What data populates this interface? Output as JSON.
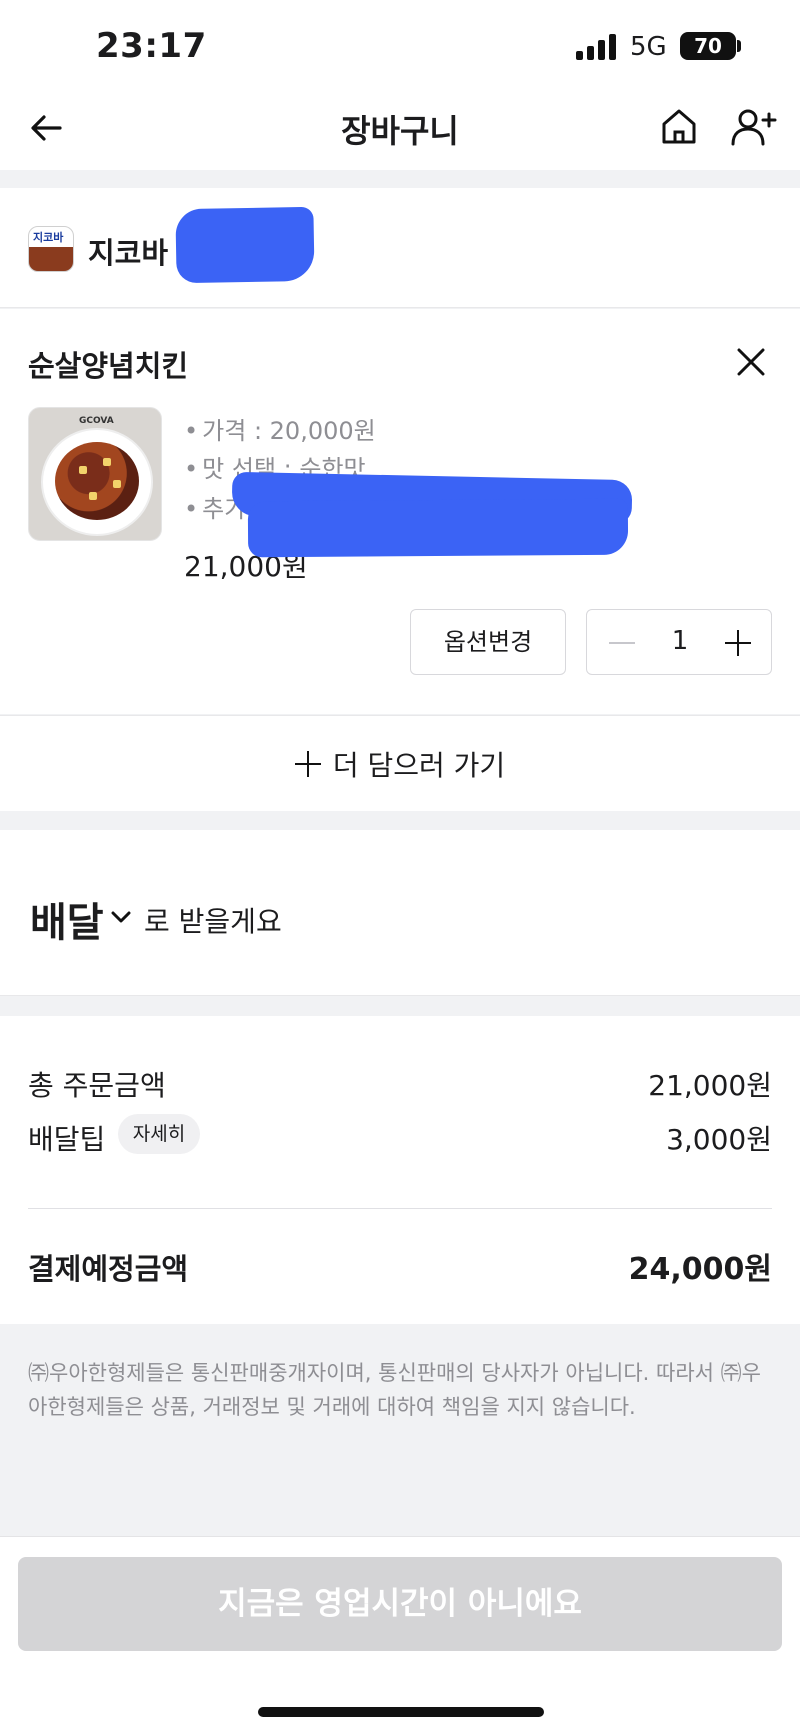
{
  "status_bar": {
    "time": "23:17",
    "network": "5G",
    "battery": "70"
  },
  "nav": {
    "title": "장바구니",
    "back_icon": "arrow-left-icon",
    "home_icon": "home-icon",
    "user_icon": "add-user-icon"
  },
  "store": {
    "name": "지코바 (",
    "logo_text": "지코바"
  },
  "item": {
    "name": "순살양념치킨",
    "options": [
      "가격 : 20,000원",
      "맛 선택 : 순한맛",
      "추가"
    ],
    "price": "21,000원",
    "option_change_label": "옵션변경",
    "quantity": "1",
    "thumb_brand": "GCOVA"
  },
  "more": {
    "label": "더 담으러 가기"
  },
  "delivery": {
    "method": "배달",
    "suffix": "로 받을게요"
  },
  "summary": {
    "order_total_label": "총 주문금액",
    "order_total_value": "21,000원",
    "delivery_tip_label": "배달팁",
    "delivery_tip_detail": "자세히",
    "delivery_tip_value": "3,000원",
    "payment_label": "결제예정금액",
    "payment_value": "24,000원"
  },
  "notice": "㈜우아한형제들은 통신판매중개자이며, 통신판매의 당사자가 아닙니다. 따라서 ㈜우아한형제들은 상품, 거래정보 및 거래에 대하여 책임을 지지 않습니다.",
  "order_button": {
    "label": "지금은 영업시간이 아니에요",
    "state": "disabled"
  },
  "colors": {
    "disabled_button": "#d4d4d6",
    "redaction": "#3b63f5",
    "muted_text": "#8e8e93"
  }
}
